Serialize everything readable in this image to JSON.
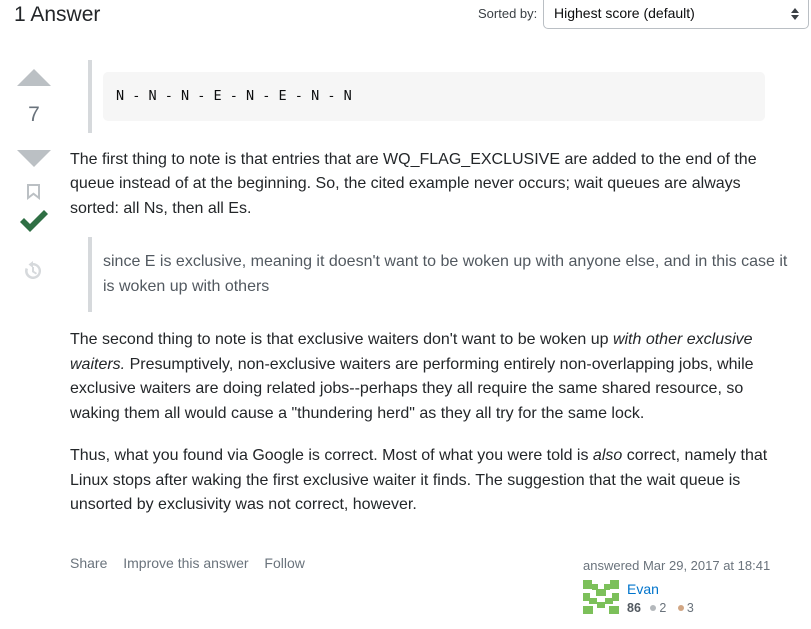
{
  "header": {
    "answer_count": "1 Answer",
    "sort_label": "Sorted by:",
    "sort_value": "Highest score (default)"
  },
  "vote": {
    "score": "7"
  },
  "post": {
    "code": "N - N - N - E - N - E - N - N",
    "para1": "The first thing to note is that entries that are WQ_FLAG_EXCLUSIVE are added to the end of the queue instead of at the beginning. So, the cited example never occurs; wait queues are always sorted: all Ns, then all Es.",
    "quote": "since E is exclusive, meaning it doesn't want to be woken up with anyone else, and in this case it is woken up with others",
    "para2_a": "The second thing to note is that exclusive waiters don't want to be woken up ",
    "para2_em": "with other exclusive waiters.",
    "para2_b": " Presumptively, non-exclusive waiters are performing entirely non-overlapping jobs, while exclusive waiters are doing related jobs--perhaps they all require the same shared resource, so waking them all would cause a \"thundering herd\" as they all try for the same lock.",
    "para3_a": "Thus, what you found via Google is correct. Most of what you were told is ",
    "para3_em": "also",
    "para3_b": " correct, namely that Linux stops after waking the first exclusive waiter it finds. The suggestion that the wait queue is unsorted by exclusivity was not correct, however."
  },
  "actions": {
    "share": "Share",
    "improve": "Improve this answer",
    "follow": "Follow"
  },
  "signature": {
    "action": "answered Mar 29, 2017 at 18:41",
    "user_name": "Evan",
    "reputation": "86",
    "silver_badges": "2",
    "bronze_badges": "3"
  },
  "colors": {
    "accepted": "#2f6f44",
    "link": "#0074cc",
    "silver": "#b4b8bc",
    "bronze": "#d1a684"
  }
}
